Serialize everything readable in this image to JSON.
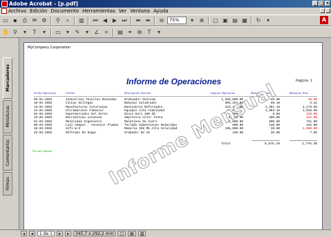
{
  "window": {
    "title": "Adobe Acrobat - [p.pdf]"
  },
  "menu": [
    "Archivo",
    "Edición",
    "Documento",
    "Herramientas",
    "Ver",
    "Ventana",
    "Ayuda"
  ],
  "toolbar": {
    "zoom": "75%"
  },
  "nav_tabs": [
    "Marcadores",
    "Miniaturas",
    "Comentarios",
    "Firmas"
  ],
  "report": {
    "company": "MyCompany Corporation",
    "title": "Informe de Operaciones",
    "page_label": "Pagina  1",
    "headers": {
      "fecha": "Fecha Operacion",
      "cliente": "Cliente",
      "descripcion": "Descripcion Articulo",
      "importe": "Importe Operacion",
      "bruto": "Beneficio Bruto",
      "neto": "Beneficio Neto"
    },
    "rows": [
      {
        "fecha": "05-01-2002",
        "cliente": "Industrias Textiles Reunidas",
        "desc": "Ordenador Pentium",
        "importe": "1,203,000.00",
        "bruto": "56.00",
        "neto": "46.00",
        "neg": true
      },
      {
        "fecha": "10-01-2002",
        "cliente": "Cintas Gallegas",
        "desc": "Bobinas Calibrador",
        "importe": "305,254.00",
        "bruto": "80.10",
        "neto": "6.41",
        "neg": false
      },
      {
        "fecha": "15-01-2002",
        "cliente": "Manufacturas Asturianas",
        "desc": "Bastidores Reforzados",
        "importe": "253,130.00",
        "bruto": "2,301.10",
        "neto": "2,178.00",
        "neg": false
      },
      {
        "fecha": "24-01-2002",
        "cliente": "Ultramarinos Almansor",
        "desc": "Equipos Alta Fidelidad",
        "importe": "85,681.00",
        "bruto": "1,903.10",
        "neto": "1,038.00",
        "neg": false
      },
      {
        "fecha": "02-02-2002",
        "cliente": "Supermercados Del Sureo",
        "desc": "Disco Duro 200 Gb",
        "importe": "2,300.00",
        "bruto": "8.50",
        "neto": "120.00",
        "neg": true
      },
      {
        "fecha": "19-02-2002",
        "cliente": "Recreativas Leonesas",
        "desc": "Impresora Color Tinta",
        "importe": "5,300.00",
        "bruto": "200.00",
        "neto": "154.00",
        "neg": true
      },
      {
        "fecha": "01-03-2002",
        "cliente": "Metalidad Ingenieros",
        "desc": "Maletines De Cuero",
        "importe": "1,600.00",
        "bruto": "800.00",
        "neto": "741.00",
        "neg": false
      },
      {
        "fecha": "08-03-2002",
        "cliente": "Luis Campos - Ascensor Plumas",
        "desc": "Teclado Dimensiones Reducidas",
        "importe": "800.00",
        "bruto": "120.00",
        "neto": "152.00",
        "neg": false
      },
      {
        "fecha": "18-03-2002",
        "cliente": "Hifi W-S",
        "desc": "Memoria 256 Mb Alta Velocidad",
        "importe": "198,000.00",
        "bruto": "20.00",
        "neto": "2,000.00",
        "neg": true
      },
      {
        "fecha": "25-03-2002",
        "cliente": "Reformas De Hogar",
        "desc": "Grabador De CD",
        "importe": "130.00",
        "bruto": "20.00",
        "neto": "7.00",
        "neg": false
      }
    ],
    "total_label": "Total",
    "total_bruto": "5,575.10",
    "total_neto": "1,776.30",
    "end_label": "Fin del informe",
    "watermark": "Informe Mensual"
  },
  "status": {
    "page": "1 de 1",
    "size": "345,7 x 292,2 mm"
  }
}
